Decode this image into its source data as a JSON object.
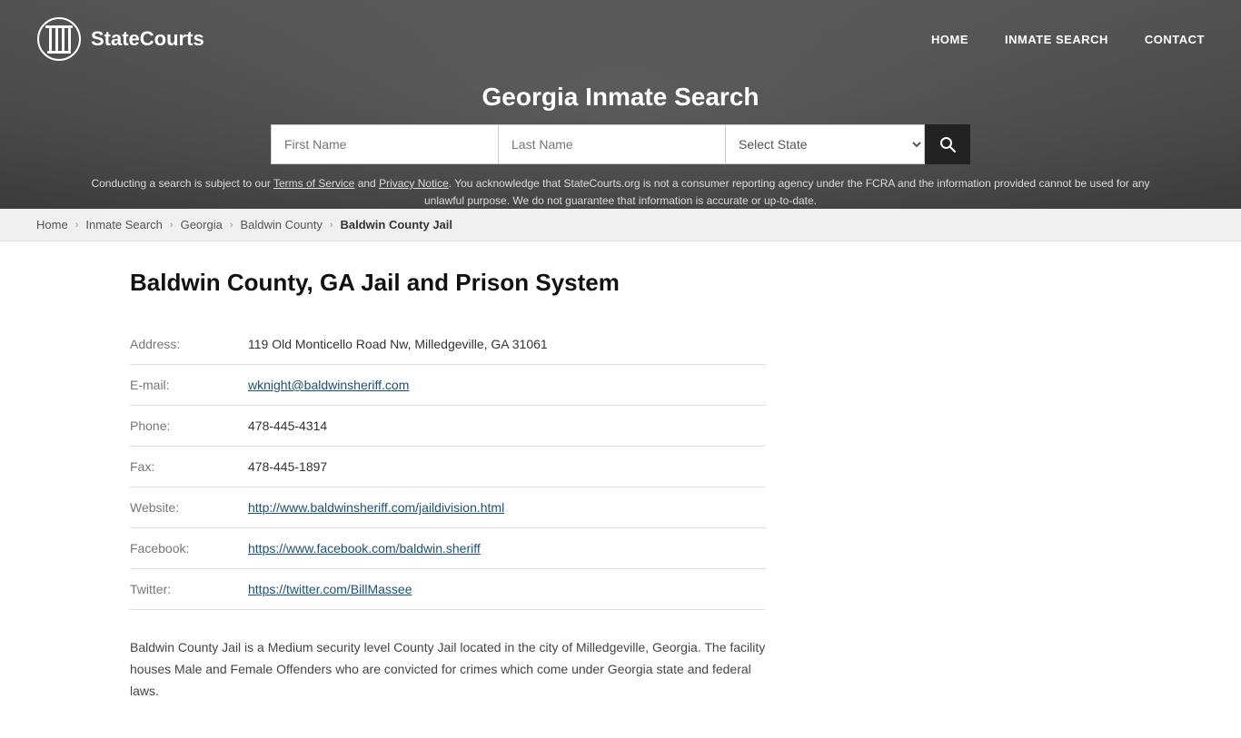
{
  "site": {
    "logo_text": "StateCourts",
    "logo_icon": "⛉"
  },
  "nav": {
    "home_label": "HOME",
    "inmate_search_label": "INMATE SEARCH",
    "contact_label": "CONTACT"
  },
  "hero": {
    "title": "Georgia Inmate Search"
  },
  "search": {
    "first_name_placeholder": "First Name",
    "last_name_placeholder": "Last Name",
    "state_placeholder": "Select State",
    "search_icon": "🔍"
  },
  "disclaimer": {
    "text_before": "Conducting a search is subject to our ",
    "terms_label": "Terms of Service",
    "text_middle": " and ",
    "privacy_label": "Privacy Notice",
    "text_after": ". You acknowledge that StateCourts.org is not a consumer reporting agency under the FCRA and the information provided cannot be used for any unlawful purpose. We do not guarantee that information is accurate or up-to-date."
  },
  "breadcrumb": {
    "home": "Home",
    "inmate_search": "Inmate Search",
    "state": "Georgia",
    "county": "Baldwin County",
    "current": "Baldwin County Jail"
  },
  "page": {
    "title": "Baldwin County, GA Jail and Prison System"
  },
  "info": {
    "address_label": "Address:",
    "address_value": "119 Old Monticello Road Nw, Milledgeville, GA 31061",
    "email_label": "E-mail:",
    "email_value": "wknight@baldwinsheriff.com",
    "email_href": "mailto:wknight@baldwinsheriff.com",
    "phone_label": "Phone:",
    "phone_value": "478-445-4314",
    "fax_label": "Fax:",
    "fax_value": "478-445-1897",
    "website_label": "Website:",
    "website_value": "http://www.baldwinsheriff.com/jaildivision.html",
    "facebook_label": "Facebook:",
    "facebook_value": "https://www.facebook.com/baldwin.sheriff",
    "twitter_label": "Twitter:",
    "twitter_value": "https://twitter.com/BillMassee"
  },
  "description": "Baldwin County Jail is a Medium security level County Jail located in the city of Milledgeville, Georgia. The facility houses Male and Female Offenders who are convicted for crimes which come under Georgia state and federal laws."
}
